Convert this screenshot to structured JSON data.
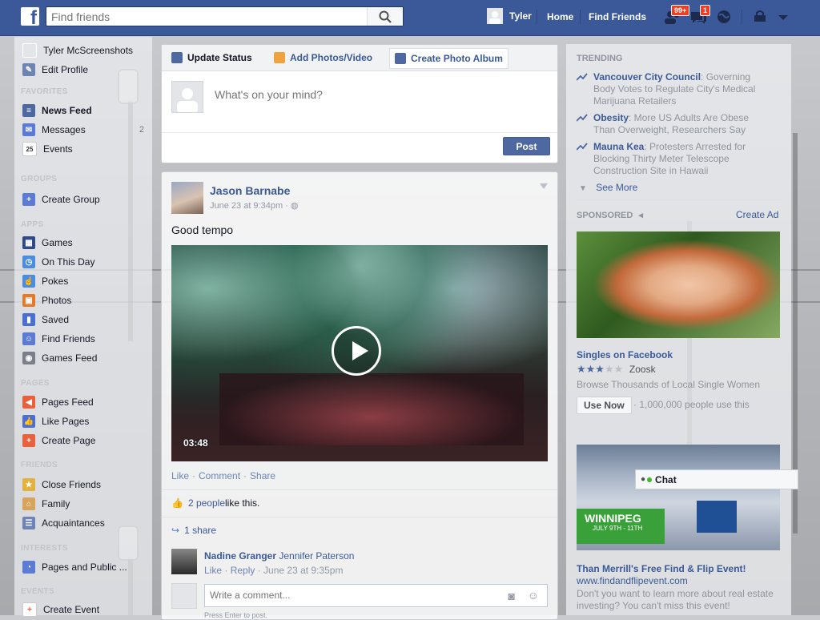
{
  "topbar": {
    "search_placeholder": "Find friends",
    "user_name": "Tyler",
    "home": "Home",
    "find_friends": "Find Friends",
    "friend_requests_badge": "99+",
    "messages_badge": "1"
  },
  "leftnav": {
    "profile_name": "Tyler McScreenshots",
    "edit_profile": "Edit Profile",
    "favorites_header": "FAVORITES",
    "favorites": [
      {
        "label": "News Feed",
        "icon": "news-feed-icon"
      },
      {
        "label": "Messages",
        "icon": "messages-icon",
        "count": "2"
      },
      {
        "label": "Events",
        "icon": "calendar-icon",
        "icon_text": "25"
      }
    ],
    "groups_header": "GROUPS",
    "create_group": "Create Group",
    "apps_header": "APPS",
    "apps": [
      {
        "label": "Games",
        "icon": "games-icon"
      },
      {
        "label": "On This Day",
        "icon": "clock-icon"
      },
      {
        "label": "Pokes",
        "icon": "poke-icon"
      },
      {
        "label": "Photos",
        "icon": "photos-icon"
      },
      {
        "label": "Saved",
        "icon": "bookmark-icon"
      },
      {
        "label": "Find Friends",
        "icon": "find-friends-icon"
      },
      {
        "label": "Games Feed",
        "icon": "gamepad-icon"
      }
    ],
    "pages_header": "PAGES",
    "pages": [
      {
        "label": "Pages Feed",
        "icon": "megaphone-icon"
      },
      {
        "label": "Like Pages",
        "icon": "thumbs-up-icon"
      },
      {
        "label": "Create Page",
        "icon": "plus-icon"
      }
    ],
    "friends_header": "FRIENDS",
    "friends": [
      {
        "label": "Close Friends",
        "icon": "star-icon"
      },
      {
        "label": "Family",
        "icon": "family-icon"
      },
      {
        "label": "Acquaintances",
        "icon": "list-icon"
      }
    ],
    "interests_header": "INTERESTS",
    "interests": [
      {
        "label": "Pages and Public ...",
        "icon": "rss-icon"
      }
    ],
    "events_header": "EVENTS",
    "events": [
      {
        "label": "Create Event",
        "icon": "calendar-plus-icon"
      }
    ]
  },
  "composer": {
    "tab_status": "Update Status",
    "tab_photos": "Add Photos/Video",
    "tab_album": "Create Photo Album",
    "placeholder": "What's on your mind?",
    "post_button": "Post"
  },
  "story": {
    "author": "Jason Barnabe",
    "timestamp": "June 23 at 9:34pm",
    "text": "Good tempo",
    "video_duration": "03:48",
    "actions": {
      "like": "Like",
      "comment": "Comment",
      "share": "Share"
    },
    "likes_count": "2 people",
    "likes_suffix": " like this.",
    "shares": "1 share",
    "comment": {
      "author": "Nadine Granger",
      "tagged": "Jennifer Paterson",
      "like": "Like",
      "reply": "Reply",
      "time": "June 23 at 9:35pm"
    },
    "write_placeholder": "Write a comment...",
    "press_enter": "Press Enter to post."
  },
  "rightcol": {
    "trending_header": "TRENDING",
    "trends": [
      {
        "topic": "Vancouver City Council",
        "desc": ": Governing Body Votes to Regulate City's Medical Marijuana Retailers"
      },
      {
        "topic": "Obesity",
        "desc": ": More US Adults Are Obese Than Overweight, Researchers Say"
      },
      {
        "topic": "Mauna Kea",
        "desc": ": Protesters Arrested for Blocking Thirty Meter Telescope Construction Site in Hawaii"
      }
    ],
    "see_more": "See More",
    "sponsored_header": "SPONSORED",
    "create_ad": "Create Ad",
    "ad1": {
      "title": "Singles on Facebook",
      "brand": "Zoosk",
      "rating_of_5": 3,
      "description": "Browse Thousands of Local Single Women",
      "cta": "Use Now",
      "social": "· 1,000,000 people use this"
    },
    "ad2": {
      "banner_text": "WINNIPEG",
      "banner_date": "JULY 9TH - 11TH",
      "title": "Than Merrill's Free Find & Flip Event!",
      "url": "www.findandflipevent.com",
      "description": "Don't you want to learn more about real estate investing? You can't miss this event!"
    }
  },
  "chat": {
    "label": "Chat"
  },
  "colors": {
    "brand_blue": "#3b5998",
    "link_blue": "#3b5998",
    "badge_red": "#f03d25",
    "online_green": "#42b72a"
  }
}
